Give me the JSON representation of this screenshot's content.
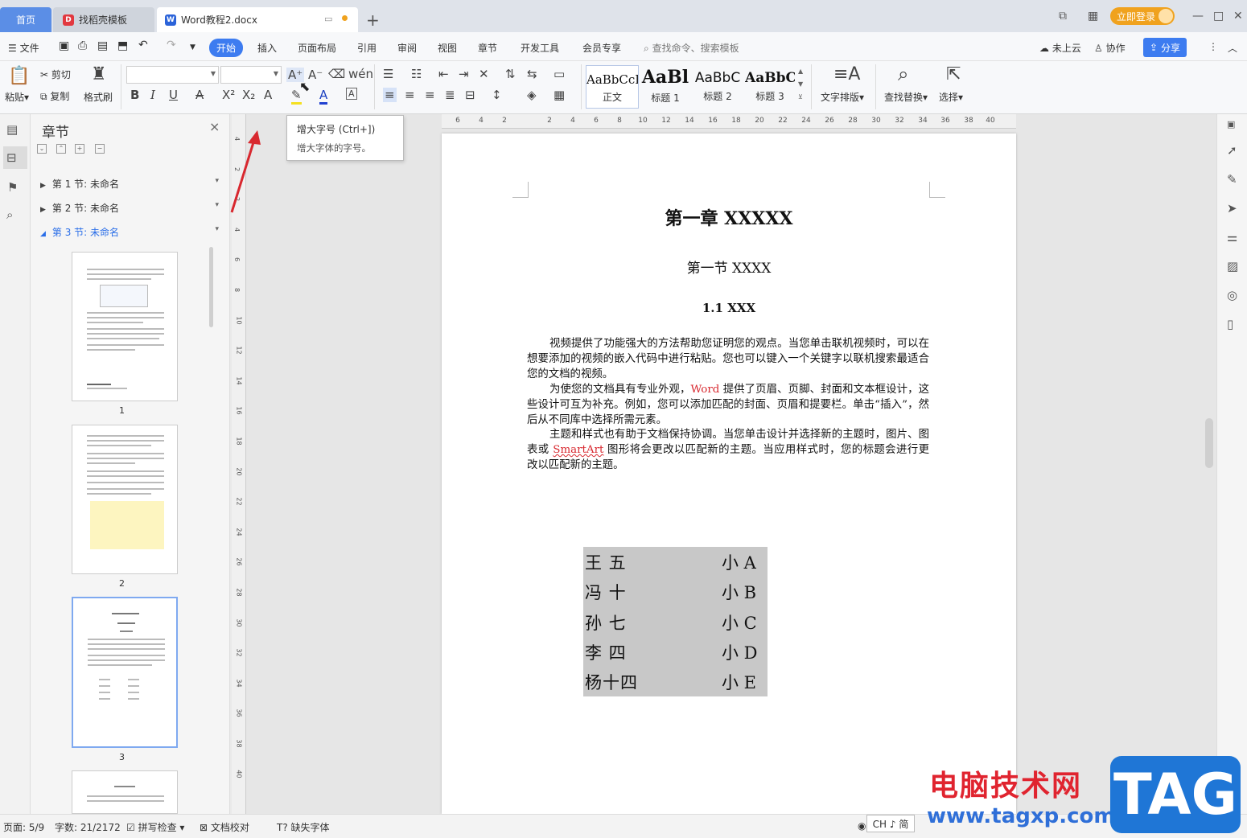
{
  "tabs": {
    "home": "首页",
    "template": "找稻壳模板",
    "document": "Word教程2.docx"
  },
  "titlebar": {
    "login": "立即登录"
  },
  "menu": {
    "file": "文件",
    "items": [
      "开始",
      "插入",
      "页面布局",
      "引用",
      "审阅",
      "视图",
      "章节",
      "开发工具",
      "会员专享"
    ],
    "search": "查找命令、搜索模板",
    "cloud": "未上云",
    "collab": "协作",
    "share": "分享"
  },
  "ribbon": {
    "paste": "粘贴",
    "cut": "剪切",
    "copy": "复制",
    "format_painter": "格式刷",
    "styles": [
      {
        "preview": "AaBbCcI",
        "label": "正文"
      },
      {
        "preview": "AaBl",
        "label": "标题 1"
      },
      {
        "preview": "AaBbC",
        "label": "标题 2"
      },
      {
        "preview": "AaBbC",
        "label": "标题 3"
      }
    ],
    "text_layout": "文字排版",
    "find_replace": "查找替换",
    "select": "选择"
  },
  "tooltip": {
    "title": "增大字号 (Ctrl+])",
    "desc": "增大字体的字号。"
  },
  "nav": {
    "title": "章节",
    "sections": [
      "第 1 节: 未命名",
      "第 2 节: 未命名",
      "第 3 节: 未命名"
    ],
    "pages": [
      "1",
      "2",
      "3"
    ]
  },
  "ruler": {
    "h": [
      "6",
      "4",
      "2",
      "2",
      "4",
      "6",
      "8",
      "10",
      "12",
      "14",
      "16",
      "18",
      "20",
      "22",
      "24",
      "26",
      "28",
      "30",
      "32",
      "34",
      "36",
      "38",
      "40"
    ],
    "v": [
      "4",
      "2",
      "2",
      "4",
      "6",
      "8",
      "10",
      "12",
      "14",
      "16",
      "18",
      "20",
      "22",
      "24",
      "26",
      "28",
      "30",
      "32",
      "34",
      "36",
      "38",
      "40"
    ]
  },
  "doc": {
    "h1": "第一章  XXXXX",
    "h2": "第一节  XXXX",
    "h3": "1.1 XXX",
    "p1": "视频提供了功能强大的方法帮助您证明您的观点。当您单击联机视频时，可以在想要添加的视频的嵌入代码中进行粘贴。您也可以键入一个关键字以联机搜索最适合您的文档的视频。",
    "p2_a": "为使您的文档具有专业外观，",
    "p2_word": "Word",
    "p2_b": " 提供了页眉、页脚、封面和文本框设计，这些设计可互为补充。例如，您可以添加匹配的封面、页眉和提要栏。单击“插入”，然后从不同库中选择所需元素。",
    "p3_a": "主题和样式也有助于文档保持协调。当您单击设计并选择新的主题时，图片、图表或 ",
    "p3_smart": "SmartArt",
    "p3_b": " 图形将会更改以匹配新的主题。当应用样式时，您的标题会进行更改以匹配新的主题。",
    "names": [
      {
        "name": "王  五",
        "tag": "小 A"
      },
      {
        "name": "冯  十",
        "tag": "小 B"
      },
      {
        "name": "孙  七",
        "tag": "小 C"
      },
      {
        "name": "李  四",
        "tag": "小 D"
      },
      {
        "name": "杨十四",
        "tag": "小 E"
      }
    ]
  },
  "status": {
    "page": "页面: 5/9",
    "words": "字数: 21/2172",
    "spell": "拼写检查",
    "proof": "文档校对",
    "missing_font": "缺失字体",
    "ime": "CH ♪ 简"
  },
  "watermark": {
    "site": "电脑技术网",
    "url": "www.tagxp.com",
    "tag": "TAG"
  },
  "colors": {
    "accent": "#3d7cf0",
    "login": "#f0a21e",
    "highlight": "#c8c8c8",
    "red_text": "#d8282f"
  }
}
